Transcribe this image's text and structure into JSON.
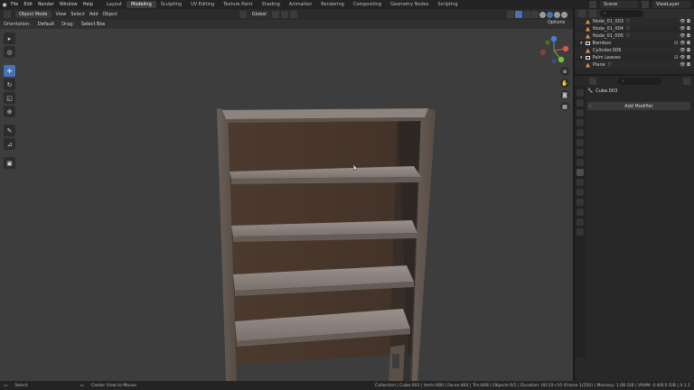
{
  "topbar": {
    "menus": [
      "File",
      "Edit",
      "Render",
      "Window",
      "Help"
    ],
    "workspaces": [
      "Layout",
      "Modeling",
      "Sculpting",
      "UV Editing",
      "Texture Paint",
      "Shading",
      "Animation",
      "Rendering",
      "Compositing",
      "Geometry Nodes",
      "Scripting"
    ],
    "active_workspace": "Modeling",
    "scene_label": "Scene",
    "view_layer_label": "ViewLayer"
  },
  "viewport_header": {
    "mode": "Object Mode",
    "menus": [
      "View",
      "Select",
      "Add",
      "Object"
    ],
    "transform_orientation": "Global"
  },
  "viewport_subheader": {
    "orientation_label": "Orientation:",
    "orientation_value": "Default",
    "drag_label": "Drag:",
    "drag_value": "Select Box",
    "options_label": "Options"
  },
  "outliner": {
    "search_placeholder": "",
    "rows": [
      {
        "name": "Node_01_003",
        "indent": 2,
        "type": "mesh"
      },
      {
        "name": "Node_01_004",
        "indent": 2,
        "type": "mesh"
      },
      {
        "name": "Node_01_005",
        "indent": 2,
        "type": "mesh"
      },
      {
        "name": "Bamboo",
        "indent": 1,
        "type": "collection"
      },
      {
        "name": "Cylinder.006",
        "indent": 2,
        "type": "mesh"
      },
      {
        "name": "Palm Leaves",
        "indent": 1,
        "type": "collection"
      },
      {
        "name": "Plane",
        "indent": 2,
        "type": "mesh"
      }
    ]
  },
  "properties": {
    "search_placeholder": "",
    "object_name": "Cube.003",
    "add_modifier_label": "Add Modifier"
  },
  "statusbar": {
    "select": "Select",
    "center_view": "Center View to Mouse",
    "stats": "Collection | Cube.003 | Verts:480 | Faces:464 | Tris:848 | Objects:0/1 | Duration: 00:10+10 (Frame 1/250) | Memory: 1.08 GiB | VRAM: 4.4/8.0 GiB | 4.1.1"
  },
  "colors": {
    "accent": "#4772b3",
    "viewport_bg": "#3d3d3d",
    "wood_light": "#8a7f78",
    "wood_dark": "#4a3a30"
  }
}
